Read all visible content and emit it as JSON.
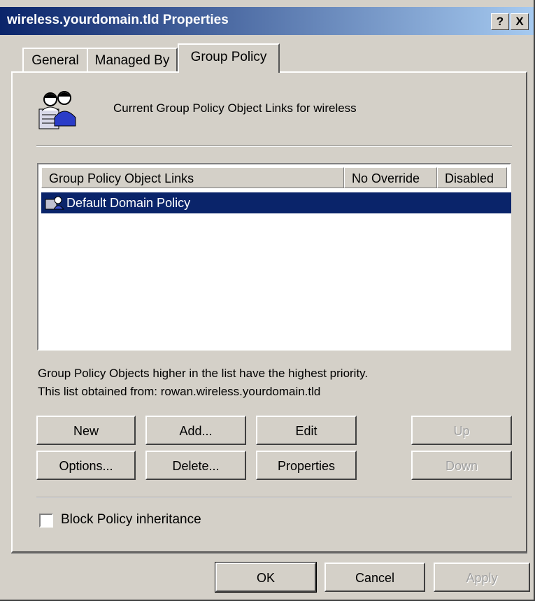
{
  "window": {
    "title": "wireless.yourdomain.tld Properties",
    "help_label": "?",
    "close_label": "X"
  },
  "tabs": [
    {
      "label": "General"
    },
    {
      "label": "Managed By"
    },
    {
      "label": "Group Policy"
    }
  ],
  "header": {
    "text": "Current Group Policy Object Links for wireless",
    "icon": "users-icon"
  },
  "list": {
    "columns": [
      "Group Policy Object Links",
      "No Override",
      "Disabled"
    ],
    "rows": [
      {
        "name": "Default Domain Policy",
        "icon": "group-policy-icon",
        "selected": true
      }
    ]
  },
  "info": {
    "line1": "Group Policy Objects higher in the list have the highest priority.",
    "line2": "This list obtained from: rowan.wireless.yourdomain.tld"
  },
  "buttons": {
    "new": "New",
    "add": "Add...",
    "edit": "Edit",
    "up": "Up",
    "options": "Options...",
    "delete": "Delete...",
    "properties": "Properties",
    "down": "Down"
  },
  "block_inheritance": {
    "label": "Block Policy inheritance",
    "checked": false
  },
  "footer": {
    "ok": "OK",
    "cancel": "Cancel",
    "apply": "Apply"
  },
  "colors": {
    "title_start": "#0a246a",
    "title_end": "#a6caf0",
    "selection": "#0a246a",
    "face": "#d4d0c8"
  }
}
